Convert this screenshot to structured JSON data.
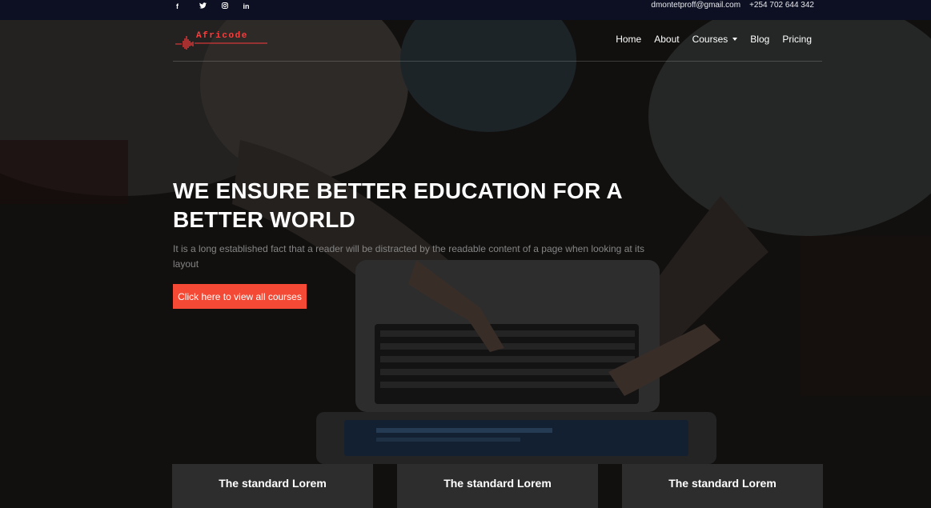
{
  "topbar": {
    "social": [
      {
        "icon": "facebook-icon",
        "glyph": "f"
      },
      {
        "icon": "twitter-icon",
        "glyph": "🐦"
      },
      {
        "icon": "instagram-icon",
        "glyph": "◎"
      },
      {
        "icon": "linkedin-icon",
        "glyph": "in"
      }
    ],
    "email": "dmontetproff@gmail.com",
    "phone": "+254 702 644 342"
  },
  "brand": {
    "name": "Africode",
    "color": "#ff3b3b"
  },
  "nav": {
    "items": [
      "Home",
      "About",
      "Courses",
      "Blog",
      "Pricing"
    ]
  },
  "hero": {
    "title": "WE ENSURE BETTER EDUCATION FOR A BETTER WORLD",
    "subtitle": "It is a long established fact that a reader will be distracted by the readable content of a page when looking at its layout",
    "cta_label": "Click here to view all courses",
    "cta_color": "#f44a35"
  },
  "cards": [
    {
      "title": "The standard Lorem"
    },
    {
      "title": "The standard Lorem"
    },
    {
      "title": "The standard Lorem"
    }
  ]
}
